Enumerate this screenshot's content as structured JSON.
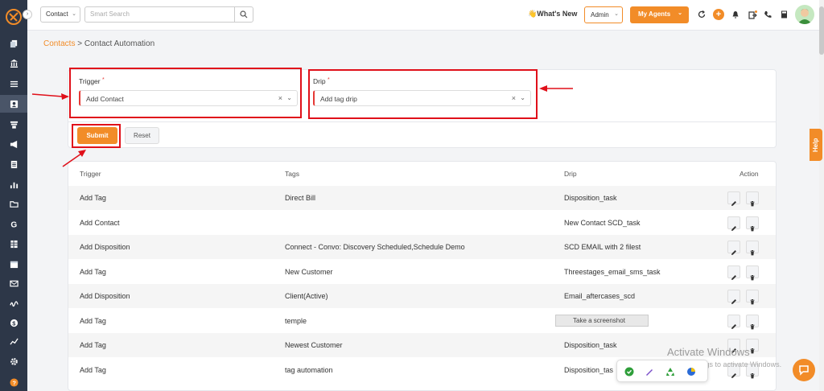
{
  "topbar": {
    "contact_select": "Contact",
    "search_placeholder": "Smart Search",
    "whats_new": "👋What's New",
    "admin_select": "Admin",
    "my_agents": "My Agents",
    "plus": "+"
  },
  "breadcrumb": {
    "parent": "Contacts",
    "separator": ">",
    "current": "Contact Automation"
  },
  "form": {
    "trigger_label": "Trigger",
    "trigger_value": "Add Contact",
    "drip_label": "Drip",
    "drip_value": "Add tag drip",
    "required_mark": "*",
    "submit_label": "Submit",
    "reset_label": "Reset"
  },
  "table": {
    "headers": {
      "trigger": "Trigger",
      "tags": "Tags",
      "drip": "Drip",
      "action": "Action"
    },
    "rows": [
      {
        "trigger": "Add Tag",
        "tags": "Direct Bill",
        "drip": "Disposition_task"
      },
      {
        "trigger": "Add Contact",
        "tags": "",
        "drip": "New Contact SCD_task"
      },
      {
        "trigger": "Add Disposition",
        "tags": "Connect - Convo: Discovery Scheduled,Schedule Demo",
        "drip": "SCD EMAIL with 2 filest"
      },
      {
        "trigger": "Add Tag",
        "tags": "New Customer",
        "drip": "Threestages_email_sms_task"
      },
      {
        "trigger": "Add Disposition",
        "tags": "Client(Active)",
        "drip": "Email_aftercases_scd"
      },
      {
        "trigger": "Add Tag",
        "tags": "temple",
        "drip": ""
      },
      {
        "trigger": "Add Tag",
        "tags": "Newest Customer",
        "drip": "Disposition_task"
      },
      {
        "trigger": "Add Tag",
        "tags": "tag automation",
        "drip": "Disposition_tas"
      }
    ]
  },
  "overlay": {
    "tooltip": "Take a screenshot",
    "watermark_title": "Activate Windows",
    "watermark_sub": "Go to Settings to activate Windows."
  },
  "help_tab": "Help",
  "colors": {
    "accent": "#f28c28",
    "sidebar": "#2d3748",
    "annotation_red": "#e0101a"
  }
}
